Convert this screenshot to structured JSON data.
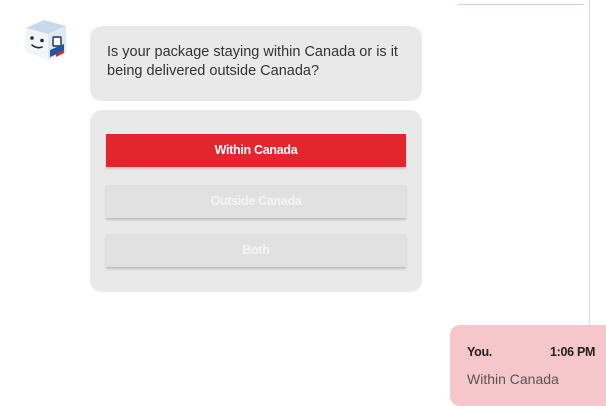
{
  "bot": {
    "avatar_icon": "canada-post-mascot-icon",
    "message": "Is your package staying within Canada or is it being delivered outside Canada?"
  },
  "choices": {
    "items": [
      {
        "label": "Within Canada",
        "selected": true
      },
      {
        "label": "Outside Canada",
        "selected": false
      },
      {
        "label": "Both",
        "selected": false
      }
    ]
  },
  "user_message": {
    "sender": "You.",
    "time": "1:06 PM",
    "text": "Within Canada"
  },
  "colors": {
    "accent_red": "#e3262d",
    "bubble_gray": "#e9e9e9",
    "user_bubble_pink": "#f5c7ca"
  }
}
